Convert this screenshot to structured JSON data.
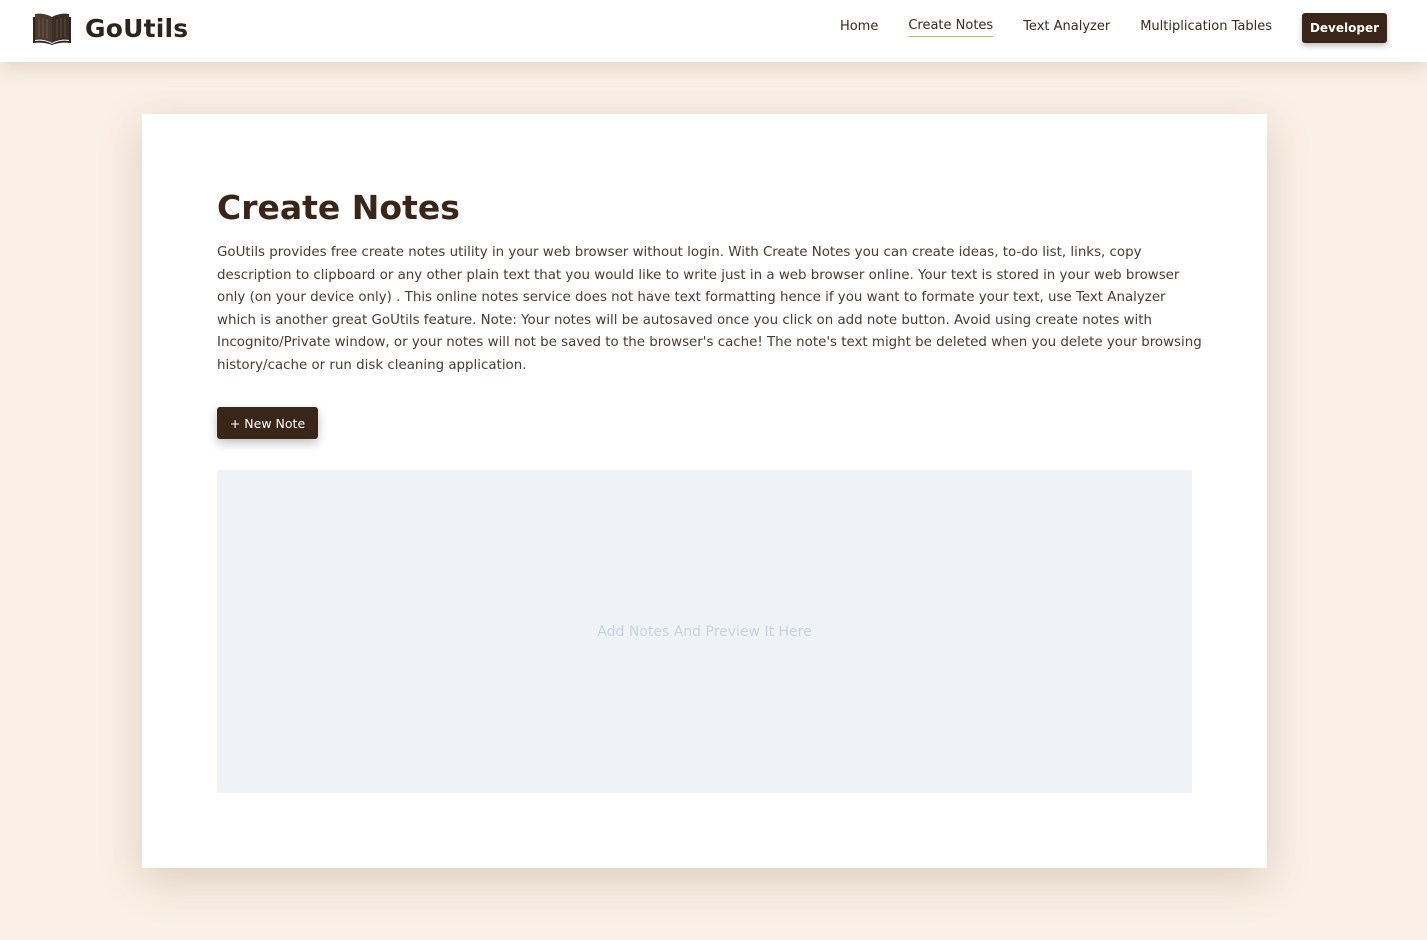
{
  "brand": {
    "name": "GoUtils",
    "logo_icon": "open-book-icon"
  },
  "nav": {
    "links": [
      {
        "label": "Home"
      },
      {
        "label": "Create Notes",
        "active": true
      },
      {
        "label": "Text Analyzer"
      },
      {
        "label": "Multiplication Tables"
      }
    ],
    "developer_label": "Developer"
  },
  "main": {
    "title": "Create Notes",
    "description": "GoUtils provides free create notes utility in your web browser without login. With Create Notes you can create ideas, to-do list, links, copy description to clipboard or any other plain text that you would like to write just in a web browser online. Your text is stored in your web browser only (on your device only) . This online notes service does not have text formatting hence if you want to formate your text, use Text Analyzer which is another great GoUtils feature. Note: Your notes will be autosaved once you click on add note button. Avoid using create notes with Incognito/Private window, or your notes will not be saved to the browser's cache! The note's text might be deleted when you delete your browsing history/cache or run disk cleaning application.",
    "new_note_label": "+ New Note",
    "preview_placeholder": "Add Notes And Preview It Here"
  },
  "colors": {
    "page_background": "#fbf0e6",
    "accent_dark": "#3a2519",
    "active_underline": "#d8b35a",
    "preview_background": "#eff3f8"
  }
}
